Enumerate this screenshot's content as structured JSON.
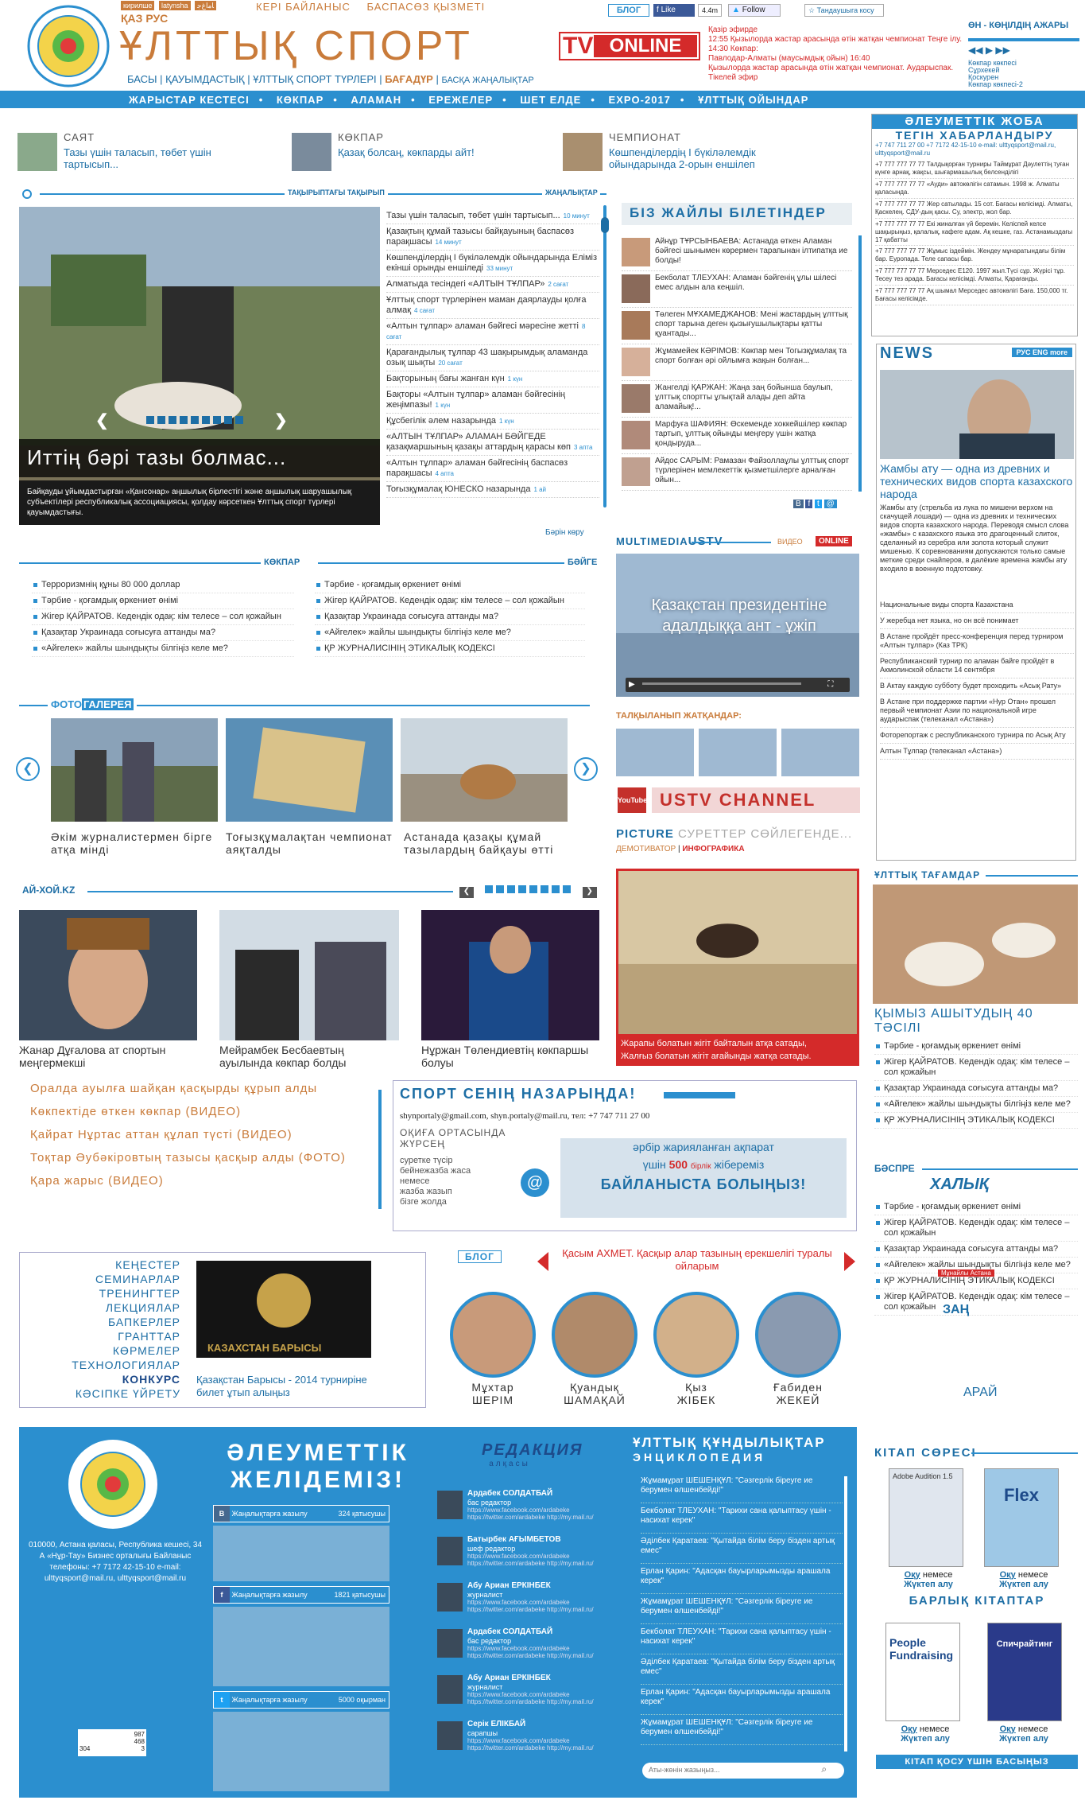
{
  "header": {
    "langs_top": [
      "кирилшe",
      "latynsha",
      "ﺎﻣﺍﻍﺟ"
    ],
    "lang_labels": "ҚАЗ  РУС",
    "links": [
      "КЕРІ БАЙЛАНЫС",
      "БАСПАСӨЗ ҚЫЗМЕТІ"
    ],
    "site_title": "ҰЛТТЫҚ СПОРТ",
    "main_nav": [
      "БАСЫ",
      "ҚАУЫМДАСТЫҚ",
      "ҰЛТТЫҚ СПОРТ ТҮРЛЕРІ",
      "БАҒАДҮР",
      "БАСҚА ЖАҢАЛЫҚТАР"
    ],
    "blog_label": "БЛОГ",
    "fb_like": "Like",
    "fb_count": "4.4m",
    "twitter_follow": "Follow",
    "login_label": "Тандаушыга косу",
    "tv": "TV",
    "online": "ONLINE",
    "tv_schedule": [
      "Қазір эфирде",
      "12:55 Қызылорда жастар арасында өтін жатқан чемпионат Теңге ілу. 14:30 Көкпар:",
      "Павлодар-Алматы (маусымдық ойын) 16:40",
      "Қызылорда жастар арасында өтін жатқан чемпионат. Аударыспак. Тікелей эфир"
    ],
    "radio_title": "ӨН - КӨҢІЛДІҢ АЖАРЫ",
    "radio_list": [
      "Көкпар көкпесі",
      "Сұрхекей",
      "Қоскурен",
      "Көкпар көкпесі-2"
    ]
  },
  "nav": [
    "ЖАРЫСТАР КЕСТЕСІ",
    "КӨКПАР",
    "АЛАМАН",
    "ЕРЕЖЕЛЕР",
    "ШЕТ ЕЛДЕ",
    "EXPO-2017",
    "ҰЛТТЫҚ ОЙЫНДАР"
  ],
  "highlights": [
    {
      "cat": "САЯТ",
      "text": "Тазы үшін таласып, төбет үшін тартысып..."
    },
    {
      "cat": "КӨКПАР",
      "text": "Қазақ болсаң, көкпарды айт!"
    },
    {
      "cat": "ЧЕМПИОНАТ",
      "text": "Көшпенділердің І бүкіләлемдік ойындарында 2-орын еншілеп"
    }
  ],
  "main_news": {
    "label": "ТАҚЫРЫПТАҒЫ ТАҚЫРЫП",
    "title": "Иттің бәрі тазы болмас...",
    "caption": "Байқауды ұйымдастырған «Қансонар» аңшылық бірлестігі және аңшылық шаруашылық субъектілері республикалық ассоциациясы, қолдау көрсеткен Ұлттық спорт түрлері қауымдастығы."
  },
  "news_feed": {
    "label": "ЖАҢАЛЫҚТАР",
    "items": [
      {
        "t": "Тазы үшін таласып, төбет үшін тартысып...",
        "m": "10 минут"
      },
      {
        "t": "Қазақтың құмай тазысы байқауының баспасөз парақшасы",
        "m": "14 минут"
      },
      {
        "t": "Көшпенділердің І бүкіләлемдік ойындарында Еліміз екінші орынды еншіледі",
        "m": "33 минут"
      },
      {
        "t": "Алматыда тесіндегі «АЛТЫН ТҰЛПАР»",
        "m": "2 сағат"
      },
      {
        "t": "Ұлттық спорт түрлерінен маман даярлауды қолға алмақ",
        "m": "4 сағат"
      },
      {
        "t": "«Алтын тұлпар» аламан бәйгесі мәресіне жетті",
        "m": "8 сағат"
      },
      {
        "t": "Қарағандылық тұлпар 43 шақырымдық аламанда озық шықты",
        "m": "20 сағат"
      },
      {
        "t": "Бақторының бағы жанған күн",
        "m": "1 күн"
      },
      {
        "t": "Бақторы «Алтын тұлпар» аламан бәйгесінің жеңімпазы!",
        "m": "1 күн"
      },
      {
        "t": "Құсбегілік әлем назарында",
        "m": "1 күн"
      },
      {
        "t": "«АЛТЫН ТҰЛПАР» АЛАМАН БӘЙГЕДЕ қазақмаршының қазақы аттардың қарасы көп",
        "m": "3 апта"
      },
      {
        "t": "«Алтын тұлпар» аламан бәйгесінің баспасөз парақшасы",
        "m": "4 апта"
      },
      {
        "t": "Тоғызқұмалақ ЮНЕСКО назарында",
        "m": "1 ай"
      }
    ],
    "see_all": "Бәрін көру"
  },
  "we_know": {
    "title": "БІЗ ЖАЙЛЫ БІЛЕТІНДЕР",
    "items": [
      "Айнұр ТҰРСЫНБАЕВА: Астанада өткен Аламан бәйгесі шынымен көрермен тарапынан ілтипатқа ие болды!",
      "Бекболат ТЛЕУХАН: Аламан бәйгенің ұлы шілесі емес алдын ала кеңшіл.",
      "Төлеген МҰХАМЕДЖАНОВ: Мені жастардың ұлттық спорт тарына деген қызығушылықтары қатты қуантады...",
      "Жұмамейек КӘРІМОВ: Көкпар мен Тогызқұмалақ та спорт болған әрі ойлымға жақын болған...",
      "Жангелді ҚАРЖАН: Жаңа заң бойынша баулып, ұлттық спортты ұлықтай алады деп айта аламайық!...",
      "Марфуға ШАФИЯН: Өскеменде хоккейшілер көкпар тартып, ұлттық ойынды меңгеру үшін жатқа қондыруда...",
      "Айдос САРЫМ: Рамазан Файзоллаұлы ұлттық спорт түрлерінен мемлекеттік қызметшілерге арналған ойын..."
    ]
  },
  "social_project": {
    "title": "ӘЛЕУМЕТТІК ЖОБА",
    "subtitle": "ТЕГІН ХАБАРЛАНДЫРУ",
    "contacts": "+7 747 711 27 00 +7 7172 42-15-10 e-mail: ulttyqsport@mail.ru, ulttyqsport@mail.ru",
    "ads": [
      "+7 777 777 77 77 Талдықорған турниры Таймұрат Дәулеттің туған күнге арнақ, жақсы, шығармашылық белсенділігі",
      "+7 777 777 77 77 «Ауди» автокөлігін сатамын. 1998 ж. Алматы қаласында.",
      "+7 777 777 77 77 Жер сатылады. 15 сот. Бағасы келісімді. Алматы, Қаскелең. СДУ-дың қасы. Су, электр, жол бар.",
      "+7 777 777 77 77 Екі жиналған үй беремін. Келіспей келсе шақырыңыз, қалалық, кафеге адам. Ақ кешке, газ. Астанамыздағы 17 қабатты",
      "+7 777 777 77 77 Жұмыс іздеймін. Жендеу мұнаратындағы білім бар. Еуропада. Теле сапасы бар.",
      "+7 777 777 77 77 Мерседес Е120. 1997 жыл.Түсі сұр. Жүрісі тұр. Тесеу тез арада. Бағасы келісімді. Алматы, Қарағанды.",
      "+7 777 777 77 77 Ақ шымал Мерседес автокөлігі Баға. 150,000 тг. Бағасы келісімде."
    ]
  },
  "news_ru": {
    "title": "NEWS",
    "langs": "РУС ENG more",
    "headline": "Жамбы ату — одна из древних и технических видов спорта казахского народа",
    "body": "Жамбы ату (стрельба из лука по мишени верхом на скачущей лошади) — одна из древних и технических видов спорта казахского народа. Переводя смысл слова «жамбы» с казахского языка это драгоценный слиток, сделанный из серебра или золота который служит мишенью. К соревнованиям допускаются только самые меткие среди снайперов, в далёкие времена жамбы ату входило в военную подготовку.",
    "items": [
      "Национальные виды спорта Казахстана",
      "У жеребца нет языка, но он всё понимает",
      "В Астане пройдёт пресс-конференция перед турниром «Алтын тұлпар» (Каз ТРК)",
      "Республиканский турнир по аламан байге пройдёт в Акмолинской области 14 сентября",
      "В Актау каждую субботу будет проходить «Асық Рату»",
      "В Астане при поддержке партии «Нур Отан» прошел первый чемпионат Азии по национальной игре аударыспак (телеканал «Астана»)",
      "Фоторепортаж с республиканского турнира по Асық Ату",
      "Алтын Тұлпар (телеканал «Астана»)"
    ]
  },
  "kokpar": {
    "label": "КӨКПАР",
    "items": [
      "Терроризмнің құны 80 000 доллар",
      "Тәрбие - қоғамдық өркениет өнімі",
      "Жігер ҚАЙРАТОВ. Кедендік одақ: кім телесе – сол қожайын",
      "Қазақтар Украинада соғысуға аттанды ма?",
      "«Айгелек» жайлы шындықты білгіңіз келе ме?"
    ]
  },
  "baige": {
    "label": "БӘЙГЕ",
    "items": [
      "Тәрбие - қоғамдық өркениет өнімі",
      "Жігер ҚАЙРАТОВ. Кедендік одақ: кім телесе – сол қожайын",
      "Қазақтар Украинада соғысуға аттанды ма?",
      "«Айгелек» жайлы шындықты білгіңіз келе ме?",
      "ҚР ЖУРНАЛИСІНІҢ ЭТИКАЛЫҚ КОДЕКСІ"
    ]
  },
  "photo_gallery": {
    "label1": "ФОТО",
    "label2": "ГАЛЕРЕЯ",
    "items": [
      "Әкім журналистермен бірге атқа мінді",
      "Тоғызқұмалақтан чемпионат аяқталды",
      "Астанада қазақы құмай тазылардың байқауы өтті"
    ]
  },
  "ai_hoi": {
    "label": "АЙ-ХОЙ.KZ",
    "items": [
      "Жанар Дұғалова ат спортын меңгермекші",
      "Мейрамбек Бесбаевтың ауылында көкпар болды",
      "Нұржан Төлендиевтің көкпаршы болуы"
    ]
  },
  "multimedia": {
    "label1": "MULTIMEDIA",
    "label2": "USTV",
    "video_label": "ВИДЕО",
    "online": "ONLINE",
    "video_title": "Қазақстан президентіне адалдыққа ант - ұжіп",
    "waiting": "ТАЛҚЫЛАНЫП ЖАТҚАНДАР:",
    "channel": "USTV CHANNEL",
    "youtube": "YouTube"
  },
  "picture": {
    "title": "PICTURE",
    "subtitle": "СУРЕТТЕР СӨЙЛЕГЕНДЕ...",
    "tabs": [
      "ДЕМОТИВАТОР",
      "ИНФОГРАФИКА"
    ],
    "caption1": "Жарапы болатын жігіт байталын атқа сатады,",
    "caption2": "Жалғыз болатын жігіт ағайынды жатқа сатады."
  },
  "food": {
    "label": "ҰЛТТЫҚ ТАҒАМДАР",
    "title": "ҚЫМЫЗ АШЫТУДЫҢ 40 ТӘСІЛІ",
    "items": [
      "Тәрбие - қоғамдық өркениет өнімі",
      "Жігер ҚАЙРАТОВ. Кедендік одақ: кім телесе – сол қожайын",
      "Қазақтар Украинада соғысуға аттанды ма?",
      "«Айгелек» жайлы шындықты білгіңіз келе ме?",
      "ҚР ЖУРНАЛИСІНІҢ ЭТИКАЛЫҚ КОДЕКСІ"
    ]
  },
  "video_list": [
    "Оралда ауылға шайқан қасқырды құрып алды",
    "Көкпектіде өткен көкпар (ВИДЕО)",
    "Қайрат Нұртас аттан құлап түсті (ВИДЕО)",
    "Тоқтар Әубәкіровтың тазысы қасқыр алды (ФОТО)",
    "Қара жарыс (ВИДЕО)"
  ],
  "attention": {
    "title": "СПОРТ СЕНІҢ НАЗАРЫҢДА!",
    "emails": "shynportaly@gmail.com, shyn.portaly@mail.ru, тел: +7 747 711 27 00",
    "box_lines": [
      "ОҚИҒА ОРТАСЫНДА",
      "ЖҮРСЕҢ"
    ],
    "small_text": [
      "суретке түсір",
      "бейнежазба жаса",
      "немесе",
      "жазба жазып",
      "бізге жолда"
    ],
    "reward1": "әрбір жарияланған ақпарат",
    "reward2": "үшін",
    "amount": "500",
    "currency": "бірлік",
    "reward3": "жібереміз",
    "contact": "БАЙЛАНЫСТА БОЛЫҢЫЗ!"
  },
  "press": {
    "label": "БӘСПРЕ",
    "logos": [
      "ХАЛЫҚ",
      "ЗАҢ",
      "АРАЙ"
    ],
    "stamp": "Мұнайлы Астана",
    "items": [
      "Тәрбие - қоғамдық өркениет өнімі",
      "Жігер ҚАЙРАТОВ. Кедендік одақ: кім телесе – сол қожайын",
      "Қазақтар Украинада соғысуға аттанды ма?",
      "«Айгелек» жайлы шындықты білгіңіз келе ме?",
      "ҚР ЖУРНАЛИСІНІҢ ЭТИКАЛЫҚ КОДЕКСІ",
      "Жігер ҚАЙРАТОВ. Кедендік одақ: кім телесе – сол қожайын"
    ]
  },
  "services": {
    "items": [
      "КЕҢЕСТЕР",
      "СЕМИНАРЛАР",
      "ТРЕНИНГТЕР",
      "ЛЕКЦИЯЛАР",
      "БАПКЕРЛЕР",
      "ГРАНТТАР",
      "КӨРМЕЛЕР",
      "ТЕХНОЛОГИЯЛАР",
      "КОНКУРС",
      "КӘСІПКЕ ҮЙРЕТУ"
    ],
    "banner": "КАЗАХСТАН БАРЫСЫ",
    "caption": "Қазақстан Барысы - 2014 турниріне билет ұтып алыңыз"
  },
  "blog": {
    "label": "БЛОГ",
    "featured": "Қасым АХМЕТ. Қасқыр алар тазының ерекшелігі туралы ойларым",
    "people": [
      {
        "first": "Мұхтар",
        "last": "ШЕРІМ"
      },
      {
        "first": "Қуандық",
        "last": "ШАМАҚАЙ"
      },
      {
        "first": "Қыз",
        "last": "ЖІБЕК"
      },
      {
        "first": "Ғабиден",
        "last": "ЖЕКЕЙ"
      }
    ]
  },
  "footer": {
    "social_title1": "ӘЛЕУМЕТТІК",
    "social_title2": "ЖЕЛІДЕМІЗ!",
    "address": "010000, Астана қаласы, Республика кешесі, 34 А «Нұр-Тау» Бизнес орталығы Байланыс телефоны: +7 7172 42-15-10 e-mail: ulttyqsport@mail.ru, ulttyqsport@mail.ru",
    "vk": {
      "label": "Жаңалықтарға жазылу",
      "count": "324 қатысушы"
    },
    "fb": {
      "label": "Жаңалықтарға жазылу",
      "count": "1821 қатысушы"
    },
    "tw": {
      "label": "Жаңалықтарға жазылу",
      "count": "5000 оқырман"
    },
    "counter": [
      "987",
      "468",
      "3"
    ],
    "counter_hits": "304",
    "editorial_title": "РЕДАКЦИЯ",
    "editorial_sub": "алқасы",
    "staff": [
      {
        "name": "Ардабек СОЛДАТБАЙ",
        "role": "бас редактор"
      },
      {
        "name": "Батырбек АҒЫМБЕТОВ",
        "role": "шеф редактор"
      },
      {
        "name": "Абу Ариан ЕРКІНБЕК",
        "role": "журналист"
      },
      {
        "name": "Ардабек СОЛДАТБАЙ",
        "role": "бас редактор"
      },
      {
        "name": "Абу Ариан ЕРКІНБЕК",
        "role": "журналист"
      },
      {
        "name": "Серік ЕЛІКБАЙ",
        "role": "сарапшы"
      }
    ],
    "staff_links": "https://www.facebook.com/ardabeke https://twitter.com/ardabeke http://my.mail.ru/",
    "values_title": "ҰЛТТЫҚ ҚҰНДЫЛЫҚТАР",
    "values_sub": "ЭНЦИКЛОПЕДИЯ",
    "values": [
      "Жұмамұрат ШЕШЕНҚҰЛ: \"Сәзгерлік біреуге ие берумен өлшенбейді!\"",
      "Бекболат ТЛЕУХАН: \"Тарихи сана қалыптасу үшін - насихат керек\"",
      "Әділбек Қаратаев: \"Қытайда білім беру бізден артық емес\"",
      "Ерлан Қарин: \"Адасқан бауырларымызды арашала керек\"",
      "Жұмамұрат ШЕШЕНҚҰЛ: \"Сәзгерлік біреуге ие берумен өлшенбейді!\"",
      "Бекболат ТЛЕУХАН: \"Тарихи сана қалыптасу үшін - насихат керек\"",
      "Әділбек Қаратаев: \"Қытайда білім беру бізден артық емес\"",
      "Ерлан Қарин: \"Адасқан бауырларымызды арашала керек\"",
      "Жұмамұрат ШЕШЕНҚҰЛ: \"Сәзгерлік біреуге ие берумен өлшенбейді!\""
    ],
    "search_placeholder": "Аты-жөнін жазыңыз..."
  },
  "books": {
    "title": "КІТАП СӨРЕСІ",
    "all": "БАРЛЫҚ КІТАПТАР",
    "read": "Оқу",
    "or": "немесе",
    "download": "Жүктеп алу",
    "add": "КІТАП ҚОСУ ҮШІН БАСЫҢЫЗ",
    "book_titles": [
      "Adobe Audition 1.5",
      "Flex",
      "People Fundraising",
      "Спичрайтинг"
    ]
  }
}
